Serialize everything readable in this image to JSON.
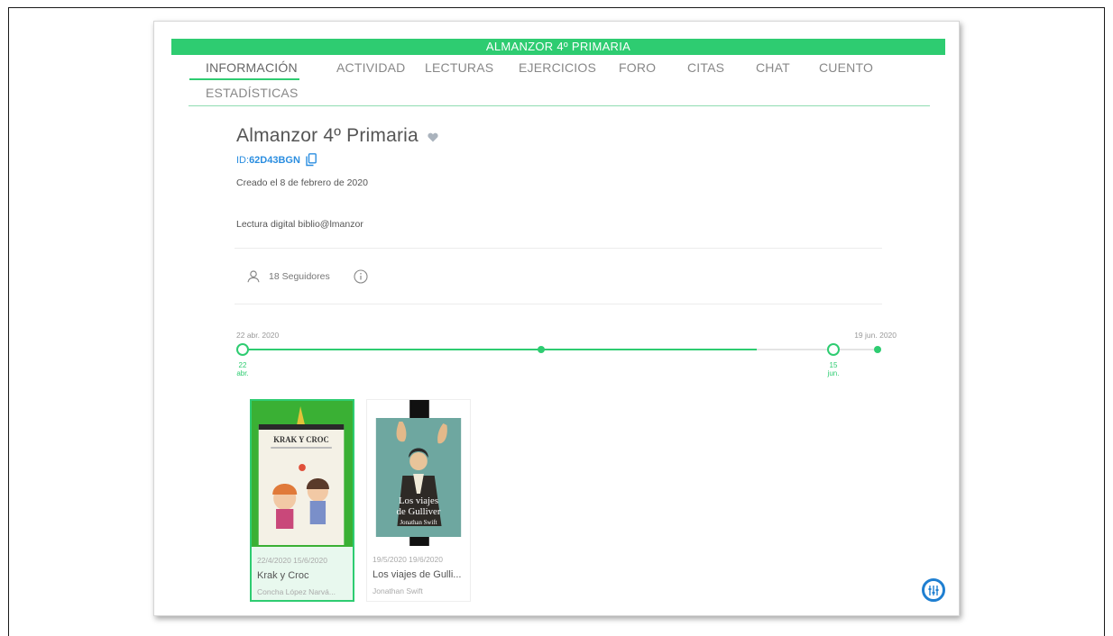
{
  "group": {
    "header": "ALMANZOR 4º PRIMARIA",
    "title": "Almanzor 4º Primaria",
    "id_label": "ID:",
    "id_value": "62D43BGN",
    "created": "Creado el 8 de febrero de 2020",
    "description": "Lectura digital biblio@lmanzor",
    "followers": "18 Seguidores"
  },
  "tabs": [
    {
      "label": "INFORMACIÓN",
      "active": true
    },
    {
      "label": "ACTIVIDAD"
    },
    {
      "label": "LECTURAS"
    },
    {
      "label": "EJERCICIOS"
    },
    {
      "label": "FORO"
    },
    {
      "label": "CITAS"
    },
    {
      "label": "CHAT"
    },
    {
      "label": "CUENTO"
    },
    {
      "label": "ESTADÍSTICAS"
    }
  ],
  "timeline": {
    "start_date": "22 abr. 2020",
    "end_date": "19 jun. 2020",
    "start_marker": [
      "22",
      "abr."
    ],
    "end_marker": [
      "15",
      "jun."
    ]
  },
  "books": [
    {
      "dates": "22/4/2020 15/6/2020",
      "title": "Krak y Croc",
      "author": "Concha López Narvá...",
      "cover_title": "KRAK Y CROC",
      "selected": true
    },
    {
      "dates": "19/5/2020 19/6/2020",
      "title": "Los viajes de Gulli...",
      "author": "Jonathan Swift",
      "cover_title": [
        "Los viajes",
        "de Gulliver",
        "Jonathan Swift"
      ],
      "selected": false
    }
  ],
  "colors": {
    "accent": "#2ecc71",
    "link": "#2b8ee0",
    "fab": "#1f7fd1"
  },
  "icons": [
    "heart-icon",
    "copy-icon",
    "user-icon",
    "info-icon",
    "settings-sliders-icon"
  ]
}
